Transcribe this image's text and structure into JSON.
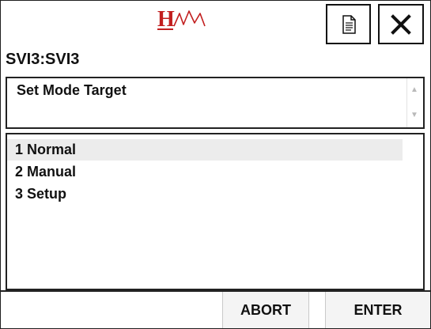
{
  "header": {
    "logo_name": "hw-logo",
    "document_icon": "document-icon",
    "close_icon": "close-icon",
    "device_title": "SVI3:SVI3"
  },
  "panel": {
    "title": "Set Mode Target"
  },
  "menu": {
    "items": [
      {
        "label": "1 Normal",
        "selected": true
      },
      {
        "label": "2 Manual",
        "selected": false
      },
      {
        "label": "3 Setup",
        "selected": false
      }
    ]
  },
  "footer": {
    "abort_label": "ABORT",
    "enter_label": "ENTER"
  },
  "colors": {
    "accent_red": "#c21f1f",
    "selection_bg": "#ececec",
    "border": "#222222"
  }
}
